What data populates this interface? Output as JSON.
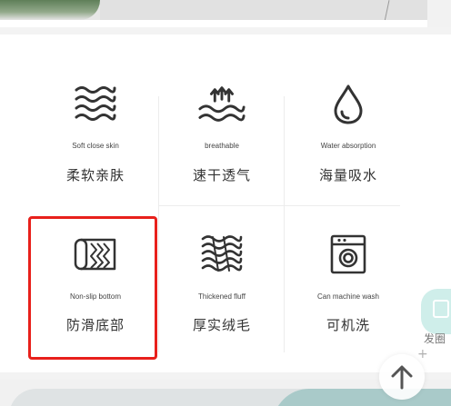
{
  "features": [
    {
      "icon": "wavy-lines-icon",
      "en": "Soft close skin",
      "zh": "柔软亲肤"
    },
    {
      "icon": "breathable-arrows-icon",
      "en": "breathable",
      "zh": "速干透气"
    },
    {
      "icon": "water-drop-icon",
      "en": "Water absorption",
      "zh": "海量吸水"
    },
    {
      "icon": "rolled-towel-icon",
      "en": "Non-slip bottom",
      "zh": "防滑底部"
    },
    {
      "icon": "thick-fluff-icon",
      "en": "Thickened fluff",
      "zh": "厚实绒毛"
    },
    {
      "icon": "washing-machine-icon",
      "en": "Can machine wash",
      "zh": "可机洗"
    }
  ],
  "side_panel": {
    "label": "发圈"
  },
  "colors": {
    "highlight": "#e8201b",
    "icon_stroke": "#333333",
    "side_float": "#cfeeea"
  }
}
